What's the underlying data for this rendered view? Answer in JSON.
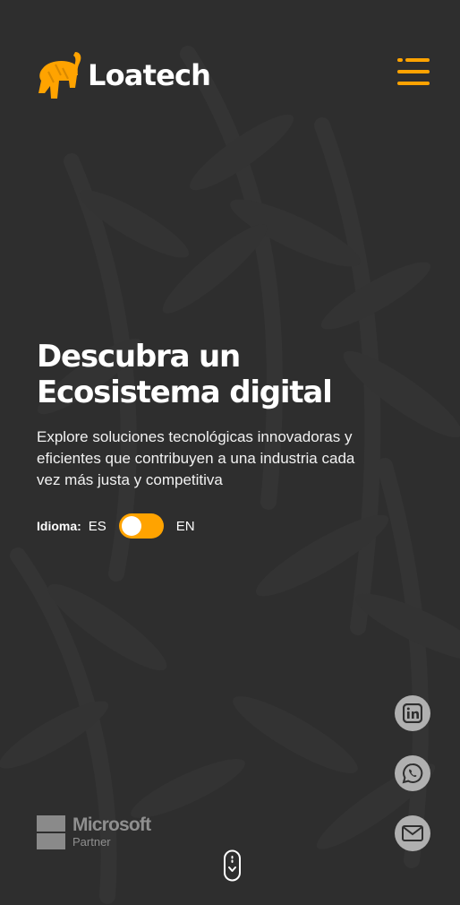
{
  "brand": {
    "name": "Loatech",
    "accent": "#ffa300",
    "background": "#2e2e2e"
  },
  "header": {
    "menu_icon": "menu-lines-icon"
  },
  "hero": {
    "title_line1": "Descubra un",
    "title_line2": "Ecosistema digital",
    "description": "Explore soluciones tecnológicas innovadoras y eficientes que contribuyen a una industria cada vez más justa y competitiva"
  },
  "language": {
    "label": "Idioma:",
    "option_left": "ES",
    "option_right": "EN",
    "selected": "ES"
  },
  "social": [
    {
      "name": "LinkedIn",
      "icon": "linkedin-icon"
    },
    {
      "name": "WhatsApp",
      "icon": "whatsapp-icon"
    },
    {
      "name": "Email",
      "icon": "mail-icon"
    }
  ],
  "partner": {
    "company": "Microsoft",
    "tier": "Partner"
  }
}
